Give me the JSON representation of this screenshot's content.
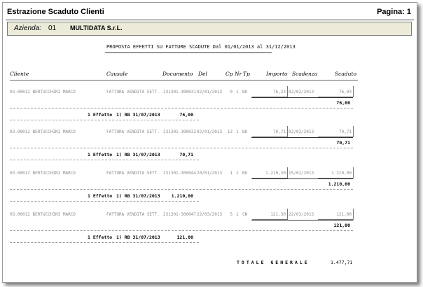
{
  "header": {
    "title": "Estrazione Scaduto Clienti",
    "page": "Pagina: 1"
  },
  "azienda": {
    "label": "Azienda:",
    "code": "01",
    "name": "MULTIDATA S.r.L."
  },
  "report_title": "PROPOSTA EFFETTI SU FATTURE SCADUTE Dal 01/01/2013 al 31/12/2013",
  "columns": {
    "cliente": "Cliente",
    "causale": "Causale",
    "documento": "Documento",
    "del": "Del",
    "cp": "Cp",
    "nr": "Nr",
    "tp": "Tp",
    "importo": "Importo",
    "scadenza": "Scadenza",
    "scaduto": "Scaduto"
  },
  "groups": [
    {
      "cliente": "03.00012 BERTUCCHINI MARCO",
      "causale": "FATTURA VENDITA SETT.",
      "documento": "231301-300031",
      "del": "02/01/2013",
      "cp": "9",
      "nr": "1",
      "tp": "BO",
      "importo": "76,23",
      "scadenza": "02/02/2013",
      "scaduto": "76,03",
      "subtotale": "76,00",
      "effetto_label": "1 Effetto",
      "effetto_rif": "1) RB 31/07/2013",
      "effetto_importo": "76,00"
    },
    {
      "cliente": "03.00012 BERTUCCHINI MARCO",
      "causale": "FATTURA VENDITA SETT.",
      "documento": "231301-300032",
      "del": "02/01/2013",
      "cp": "13",
      "nr": "1",
      "tp": "BO",
      "importo": "70,71",
      "scadenza": "02/02/2013",
      "scaduto": "70,71",
      "subtotale": "70,71",
      "effetto_label": "1 Effetto",
      "effetto_rif": "1) RB 31/07/2013",
      "effetto_importo": "70,71"
    },
    {
      "cliente": "03.00012 BERTUCCHINI MARCO",
      "causale": "FATTURA VENDITA SETT.",
      "documento": "231301-300044",
      "del": "20/01/2013",
      "cp": "1",
      "nr": "1",
      "tp": "BO",
      "importo": "1.210,30",
      "scadenza": "15/02/2013",
      "scaduto": "1.210,00",
      "subtotale": "1.210,00",
      "effetto_label": "1 Effetto",
      "effetto_rif": "1) RB 31/07/2013",
      "effetto_importo": "1.210,00"
    },
    {
      "cliente": "03.00012 BERTUCCHINI MARCO",
      "causale": "FATTURA VENDITA SETT.",
      "documento": "231301-300047",
      "del": "22/03/2013",
      "cp": "5",
      "nr": "1",
      "tp": "CN",
      "importo": "121,30",
      "scadenza": "22/03/2013",
      "scaduto": "121,00",
      "subtotale": "121,00",
      "effetto_label": "1 Effetto",
      "effetto_rif": "1) RB 31/07/2013",
      "effetto_importo": "121,00"
    }
  ],
  "totale": {
    "label": "TOTALE GENERALE",
    "value": "1.477,71"
  }
}
